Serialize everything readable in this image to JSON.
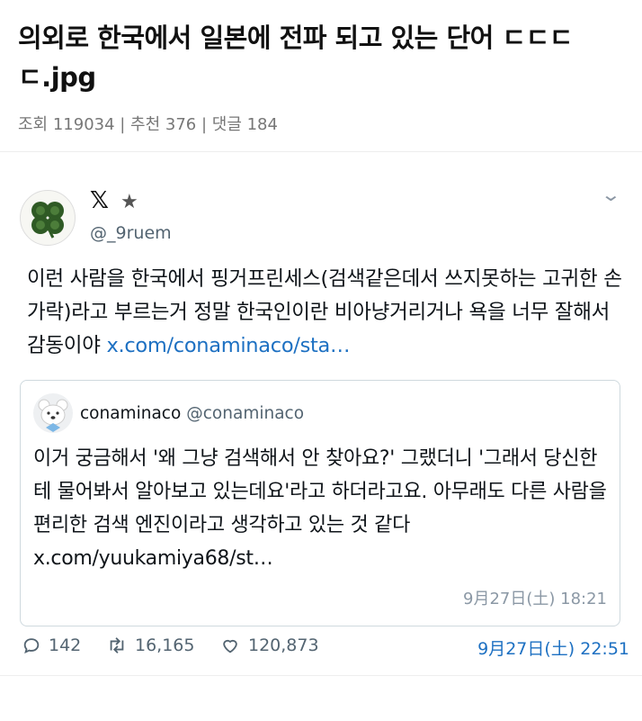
{
  "post": {
    "title": "의외로 한국에서 일본에 전파 되고 있는 단어 ㄷㄷㄷㄷ.jpg",
    "meta": "조회 119034 | 추천 376 | 댓글 184"
  },
  "tweet": {
    "platform_mark": "𝕏",
    "star": "★",
    "handle": "@_9ruem",
    "text": "이런 사람을 한국에서 핑거프린세스(검색같은데서 쓰지못하는 고귀한 손가락)라고 부르는거 정말 한국인이란 비아냥거리거나 욕을 너무 잘해서 감동이야 ",
    "link": "x.com/conaminaco/sta…",
    "chevron": "⌄",
    "quote": {
      "name": "conaminaco",
      "handle": "@conaminaco",
      "text": "이거 궁금해서 '왜 그냥 검색해서 안 찾아요?' 그랬더니 '그래서 당신한테 물어봐서 알아보고 있는데요'라고 하더라고요. 아무래도 다른 사람을 편리한 검색 엔진이라고 생각하고 있는 것 같다 ",
      "link": "x.com/yuukamiya68/st…",
      "date": "9月27日(土) 18:21"
    },
    "stats": {
      "replies": "142",
      "retweets": "16,165",
      "likes": "120,873"
    },
    "date": "9月27日(土) 22:51"
  },
  "icons": {
    "avatar": "clover-icon",
    "quote_avatar": "bear-icon",
    "reply": "reply-icon",
    "retweet": "retweet-icon",
    "like": "heart-icon"
  },
  "colors": {
    "link": "#1d70c2",
    "muted": "#536471",
    "border": "#cfd9de"
  }
}
